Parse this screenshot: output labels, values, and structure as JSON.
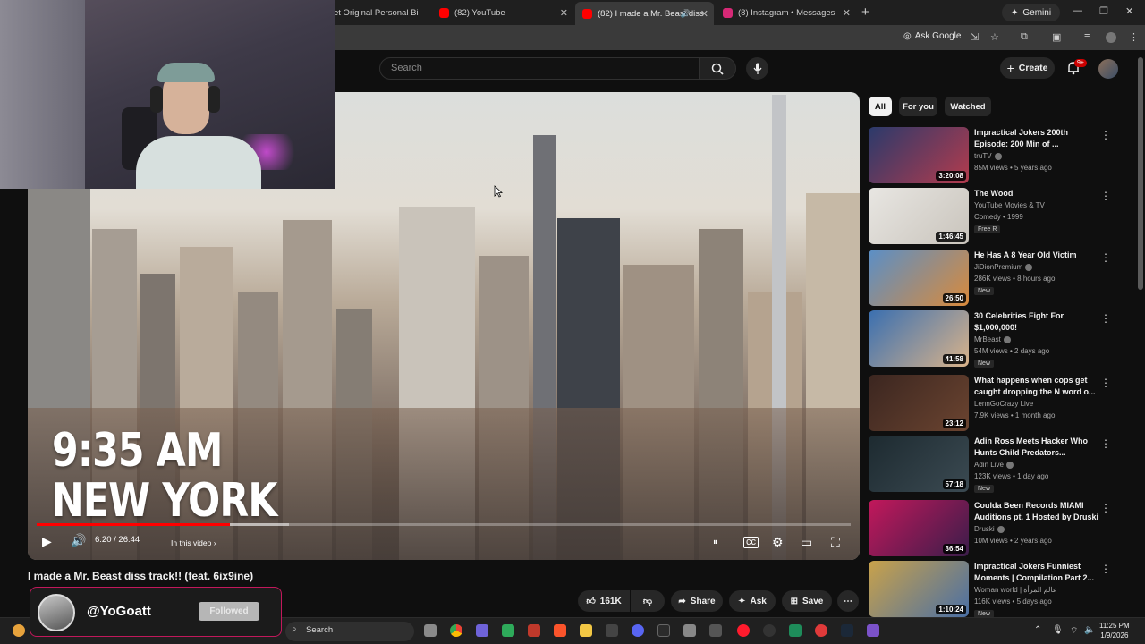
{
  "browser": {
    "tabs": [
      {
        "label": "et Original Personal Bi",
        "active": false,
        "favicon_color": "#e34c26"
      },
      {
        "label": "(82) YouTube",
        "active": false,
        "favicon_color": "#ff0000"
      },
      {
        "label": "(82) I made a Mr. Beast diss",
        "active": true,
        "favicon_color": "#ff0000"
      },
      {
        "label": "(8) Instagram • Messages",
        "active": false,
        "favicon_color": "#d62976"
      }
    ],
    "gemini_label": "Gemini",
    "ask_google_label": "Ask Google"
  },
  "header": {
    "search_placeholder": "Search",
    "create_label": "Create",
    "notifications_badge": "9+"
  },
  "player": {
    "overlay_line1": "9:35 AM",
    "overlay_line2": "NEW YORK",
    "time_display": "6:20 / 26:44",
    "in_this_video": "In this video",
    "progress_fraction": 0.237,
    "loaded_fraction": 0.31
  },
  "video": {
    "title": "I made a Mr. Beast diss track!! (feat. 6ix9ine)",
    "likes": "161K",
    "share_label": "Share",
    "ask_label": "Ask",
    "save_label": "Save"
  },
  "follow_card": {
    "handle": "@YoGoatt",
    "button_label": "Followed"
  },
  "filters": [
    "All",
    "For you",
    "Watched"
  ],
  "recommendations": [
    {
      "title": "Impractical Jokers 200th Episode: 200 Min of ...",
      "channel": "truTV",
      "verified": true,
      "meta": "85M views • 5 years ago",
      "duration": "3:20:08",
      "badge": "",
      "thumb_colors": [
        "#2b3a6b",
        "#b33b4d"
      ]
    },
    {
      "title": "The Wood",
      "channel": "YouTube Movies & TV",
      "verified": false,
      "meta": "Comedy • 1999",
      "duration": "1:46:45",
      "badge": "Free  R",
      "thumb_colors": [
        "#e8e6e2",
        "#c9c4bc"
      ]
    },
    {
      "title": "He Has A 8 Year Old Victim",
      "channel": "JiDionPremium",
      "verified": true,
      "meta": "286K views • 8 hours ago",
      "duration": "26:50",
      "badge": "New",
      "thumb_colors": [
        "#5a8fc7",
        "#d98a3b"
      ]
    },
    {
      "title": "30 Celebrities Fight For $1,000,000!",
      "channel": "MrBeast",
      "verified": true,
      "meta": "54M views • 2 days ago",
      "duration": "41:58",
      "badge": "New",
      "thumb_colors": [
        "#3a6fb0",
        "#d9b38a"
      ]
    },
    {
      "title": "What happens when cops get caught dropping the N word o...",
      "channel": "LennGoCrazy Live",
      "verified": false,
      "meta": "7.9K views • 1 month ago",
      "duration": "23:12",
      "badge": "",
      "thumb_colors": [
        "#3b2620",
        "#6b4430"
      ]
    },
    {
      "title": "Adin Ross Meets Hacker Who Hunts Child Predators...",
      "channel": "Adin Live",
      "verified": true,
      "meta": "123K views • 1 day ago",
      "duration": "57:18",
      "badge": "New",
      "thumb_colors": [
        "#1d2a30",
        "#3b4a52"
      ]
    },
    {
      "title": "Coulda Been Records MIAMI Auditions pt. 1 Hosted by Druski",
      "channel": "Druski",
      "verified": true,
      "meta": "10M views • 2 years ago",
      "duration": "36:54",
      "badge": "",
      "thumb_colors": [
        "#c2185b",
        "#3a1d4a"
      ]
    },
    {
      "title": "Impractical Jokers Funniest Moments | Compilation Part 2...",
      "channel": "Woman world | عالم المرأة",
      "verified": false,
      "meta": "116K views • 5 days ago",
      "duration": "1:10:24",
      "badge": "New",
      "thumb_colors": [
        "#c9a24a",
        "#4a6fa5"
      ]
    }
  ],
  "taskbar": {
    "search_placeholder": "Search",
    "time": "11:25 PM",
    "date": "1/9/2026"
  }
}
